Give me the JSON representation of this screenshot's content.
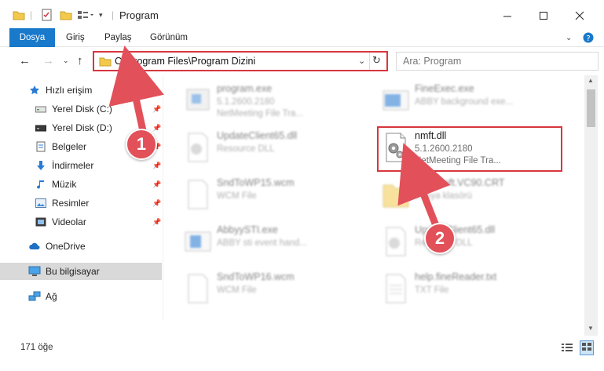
{
  "window": {
    "title": "Program"
  },
  "ribbon": {
    "tabs": [
      "Dosya",
      "Giriş",
      "Paylaş",
      "Görünüm"
    ]
  },
  "address": {
    "path": "C:\\Program Files\\Program Dizini",
    "search_placeholder": "Ara: Program"
  },
  "sidebar": {
    "items": [
      {
        "label": "Hızlı erişim",
        "icon": "star-icon"
      },
      {
        "label": "Yerel Disk (C:)",
        "icon": "drive-icon"
      },
      {
        "label": "Yerel Disk (D:)",
        "icon": "drive-icon"
      },
      {
        "label": "Belgeler",
        "icon": "documents-icon"
      },
      {
        "label": "İndirmeler",
        "icon": "download-icon"
      },
      {
        "label": "Müzik",
        "icon": "music-icon"
      },
      {
        "label": "Resimler",
        "icon": "pictures-icon"
      },
      {
        "label": "Videolar",
        "icon": "videos-icon"
      },
      {
        "label": "OneDrive",
        "icon": "cloud-icon"
      },
      {
        "label": "Bu bilgisayar",
        "icon": "computer-icon"
      },
      {
        "label": "Ağ",
        "icon": "network-icon"
      }
    ]
  },
  "files": [
    {
      "name": "program.exe",
      "meta1": "5.1.2600.2180",
      "meta2": "NetMeeting File Tra..."
    },
    {
      "name": "FineExec.exe",
      "meta1": "ABBY background exe...",
      "meta2": ""
    },
    {
      "name": "UpdateClient65.dll",
      "meta1": "Resource DLL",
      "meta2": ""
    },
    {
      "name": "nmft.dll",
      "meta1": "5.1.2600.2180",
      "meta2": "NetMeeting File Tra..."
    },
    {
      "name": "SndToWP15.wcm",
      "meta1": "WCM File",
      "meta2": ""
    },
    {
      "name": "Microsoft.VC90.CRT",
      "meta1": "Dosya klasörü",
      "meta2": ""
    },
    {
      "name": "AbbyySTI.exe",
      "meta1": "ABBY sti event hand...",
      "meta2": ""
    },
    {
      "name": "UpdateClient65.dll",
      "meta1": "Resource DLL",
      "meta2": ""
    },
    {
      "name": "SndToWP16.wcm",
      "meta1": "WCM File",
      "meta2": ""
    },
    {
      "name": "help.fineReader.txt",
      "meta1": "TXT File",
      "meta2": ""
    }
  ],
  "status": {
    "count": "171 öğe"
  },
  "annotations": [
    "1",
    "2"
  ],
  "colors": {
    "accent": "#1979ca",
    "highlight": "#d9363e",
    "badge": "#e2505a"
  }
}
